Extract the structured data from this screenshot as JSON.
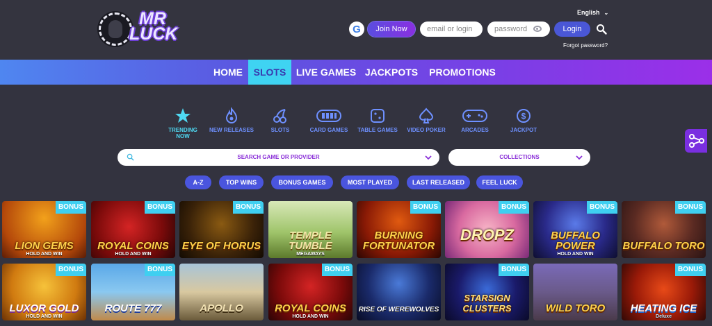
{
  "header": {
    "logo_line1": "MR",
    "logo_line2": "LUCK",
    "google_glyph": "G",
    "join_label": "Join Now",
    "email_placeholder": "email or login",
    "password_placeholder": "password",
    "login_label": "Login",
    "language": "English",
    "forgot_label": "Forgot password?"
  },
  "nav": {
    "items": [
      "HOME",
      "SLOTS",
      "LIVE GAMES",
      "JACKPOTS",
      "PROMOTIONS"
    ],
    "active": "SLOTS"
  },
  "categories": [
    {
      "label": "TRENDING NOW",
      "icon": "star-icon",
      "active": true
    },
    {
      "label": "NEW RELEASES",
      "icon": "flame-icon"
    },
    {
      "label": "SLOTS",
      "icon": "cherries-icon"
    },
    {
      "label": "CARD GAMES",
      "icon": "cards-icon"
    },
    {
      "label": "TABLE GAMES",
      "icon": "dice-icon"
    },
    {
      "label": "VIDEO POKER",
      "icon": "spade-icon"
    },
    {
      "label": "ARCADES",
      "icon": "gamepad-icon"
    },
    {
      "label": "JACKPOT",
      "icon": "dollar-coin-icon"
    }
  ],
  "search": {
    "placeholder": "SEARCH GAME OR PROVIDER",
    "collections_label": "COLLECTIONS"
  },
  "filters": [
    "A-Z",
    "TOP WINS",
    "BONUS GAMES",
    "MOST PLAYED",
    "LAST RELEASED",
    "FEEL LUCK"
  ],
  "games": {
    "badge_label": "BONUS",
    "row1": [
      {
        "title": "LION GEMS",
        "sub": "HOLD AND WIN",
        "bonus": true
      },
      {
        "title": "ROYAL COINS",
        "sub": "HOLD AND WIN",
        "bonus": true
      },
      {
        "title": "EYE OF HORUS",
        "sub": "",
        "bonus": true
      },
      {
        "title": "TEMPLE TUMBLE",
        "sub": "MEGAWAYS",
        "bonus": false
      },
      {
        "title": "BURNING FORTUNATOR",
        "sub": "",
        "bonus": true
      },
      {
        "title": "DROPZ",
        "sub": "",
        "bonus": true
      },
      {
        "title": "BUFFALO POWER",
        "sub": "HOLD AND WIN",
        "bonus": true
      },
      {
        "title": "BUFFALO TORO",
        "sub": "",
        "bonus": true
      }
    ],
    "row2": [
      {
        "title": "LUXOR GOLD",
        "sub": "HOLD AND WIN",
        "bonus": true
      },
      {
        "title": "ROUTE 777",
        "sub": "",
        "bonus": true
      },
      {
        "title": "APOLLO",
        "sub": "",
        "bonus": false
      },
      {
        "title": "ROYAL COINS",
        "sub": "HOLD AND WIN",
        "bonus": true
      },
      {
        "title": "RISE OF WEREWOLVES",
        "sub": "",
        "bonus": false
      },
      {
        "title": "STARSIGN CLUSTERS",
        "sub": "",
        "bonus": true
      },
      {
        "title": "WILD TORO",
        "sub": "",
        "bonus": false
      },
      {
        "title": "HEATING ICE",
        "sub": "Deluxe",
        "bonus": true
      }
    ]
  },
  "colors": {
    "background": "#33333f",
    "accent_cyan": "#3fd3f2",
    "pill_blue": "#4a55de",
    "purple": "#8a2fd8"
  }
}
